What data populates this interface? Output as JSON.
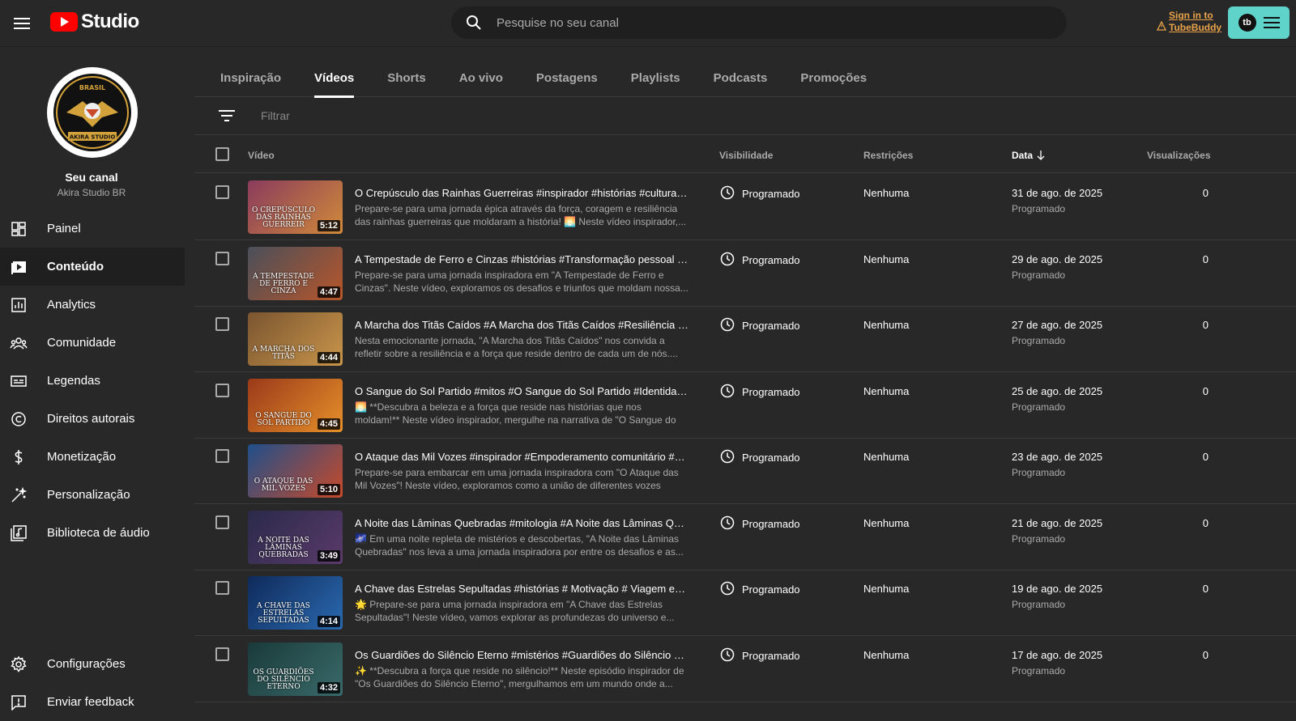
{
  "header": {
    "logo_text": "Studio",
    "search_placeholder": "Pesquise no seu canal",
    "tubebuddy_sign_line1": "Sign in to",
    "tubebuddy_sign_line2": "TubeBuddy",
    "tubebuddy_badge": "tb"
  },
  "sidebar": {
    "channel_title": "Seu canal",
    "channel_name": "Akira Studio BR",
    "avatar_text_top": "BRASIL",
    "avatar_text_bottom": "AKIRA STUDIO",
    "items": [
      {
        "label": "Painel",
        "icon": "dashboard-icon"
      },
      {
        "label": "Conteúdo",
        "icon": "content-icon"
      },
      {
        "label": "Analytics",
        "icon": "analytics-icon"
      },
      {
        "label": "Comunidade",
        "icon": "community-icon"
      },
      {
        "label": "Legendas",
        "icon": "subtitles-icon"
      },
      {
        "label": "Direitos autorais",
        "icon": "copyright-icon"
      },
      {
        "label": "Monetização",
        "icon": "dollar-icon"
      },
      {
        "label": "Personalização",
        "icon": "magic-wand-icon"
      },
      {
        "label": "Biblioteca de áudio",
        "icon": "audio-library-icon"
      }
    ],
    "bottom": [
      {
        "label": "Configurações",
        "icon": "gear-icon"
      },
      {
        "label": "Enviar feedback",
        "icon": "feedback-icon"
      }
    ]
  },
  "tabs": [
    "Inspiração",
    "Vídeos",
    "Shorts",
    "Ao vivo",
    "Postagens",
    "Playlists",
    "Podcasts",
    "Promoções"
  ],
  "active_tab": "Vídeos",
  "filter_placeholder": "Filtrar",
  "columns": {
    "video": "Vídeo",
    "visibility": "Visibilidade",
    "restrictions": "Restrições",
    "date": "Data",
    "views": "Visualizações"
  },
  "videos": [
    {
      "title": "O Crepúsculo das Rainhas Guerreiras #inspirador #histórias #cultura #i...",
      "desc": "Prepare-se para uma jornada épica através da força, coragem e resiliência das rainhas guerreiras que moldaram a história! 🌅 Neste vídeo inspirador,...",
      "duration": "5:12",
      "thumb_text": "O CREPÚSCULO DAS RAINHAS GUERREIR",
      "visibility": "Programado",
      "restrictions": "Nenhuma",
      "date": "31 de ago. de 2025",
      "date_status": "Programado",
      "views": "0",
      "colors": [
        "#8a3b5c",
        "#d08a3a"
      ]
    },
    {
      "title": "A Tempestade de Ferro e Cinzas #histórias #Transformação pessoal #...",
      "desc": "Prepare-se para uma jornada inspiradora em \"A Tempestade de Ferro e Cinzas\". Neste vídeo, exploramos os desafios e triunfos que moldam nossa...",
      "duration": "4:47",
      "thumb_text": "A TEMPESTADE DE FERRO E CINZA",
      "visibility": "Programado",
      "restrictions": "Nenhuma",
      "date": "29 de ago. de 2025",
      "date_status": "Programado",
      "views": "0",
      "colors": [
        "#4a4f5a",
        "#b8562a"
      ]
    },
    {
      "title": "A Marcha dos Titãs Caídos #A Marcha dos Titãs Caídos #Resiliência #...",
      "desc": "Nesta emocionante jornada, \"A Marcha dos Titãs Caídos\" nos convida a refletir sobre a resiliência e a força que reside dentro de cada um de nós....",
      "duration": "4:44",
      "thumb_text": "A MARCHA DOS TITÃS",
      "visibility": "Programado",
      "restrictions": "Nenhuma",
      "date": "27 de ago. de 2025",
      "date_status": "Programado",
      "views": "0",
      "colors": [
        "#7a5530",
        "#c9954a"
      ]
    },
    {
      "title": "O Sangue do Sol Partido #mitos #O Sangue do Sol Partido #Identidade ...",
      "desc": "🌅 **Descubra a beleza e a força que reside nas histórias que nos moldam!** Neste vídeo inspirador, mergulhe na narrativa de \"O Sangue do Sol Partido\",...",
      "duration": "4:45",
      "thumb_text": "O SANGUE DO SOL PARTIDO",
      "visibility": "Programado",
      "restrictions": "Nenhuma",
      "date": "25 de ago. de 2025",
      "date_status": "Programado",
      "views": "0",
      "colors": [
        "#9a3a1a",
        "#e6902a"
      ]
    },
    {
      "title": "O Ataque das Mil Vozes #inspirador #Empoderamento comunitário #E...",
      "desc": "Prepare-se para embarcar em uma jornada inspiradora com \"O Ataque das Mil Vozes\"! Neste vídeo, exploramos como a união de diferentes vozes pode...",
      "duration": "5:10",
      "thumb_text": "O ATAQUE DAS MIL VOZES",
      "visibility": "Programado",
      "restrictions": "Nenhuma",
      "date": "23 de ago. de 2025",
      "date_status": "Programado",
      "views": "0",
      "colors": [
        "#1f4f8a",
        "#c84a2a"
      ]
    },
    {
      "title": "A Noite das Lâminas Quebradas #mitologia #A Noite das Lâminas Que...",
      "desc": "🌌 Em uma noite repleta de mistérios e descobertas, \"A Noite das Lâminas Quebradas\" nos leva a uma jornada inspiradora por entre os desafios e as...",
      "duration": "3:49",
      "thumb_text": "A NOITE DAS LÂMINAS QUEBRADAS",
      "visibility": "Programado",
      "restrictions": "Nenhuma",
      "date": "21 de ago. de 2025",
      "date_status": "Programado",
      "views": "0",
      "colors": [
        "#2a2a4a",
        "#5a3a6a"
      ]
    },
    {
      "title": "A Chave das Estrelas Sepultadas #histórias # Motivação # Viagem espi...",
      "desc": "🌟 Prepare-se para uma jornada inspiradora em \"A Chave das Estrelas Sepultadas\"! Neste vídeo, vamos explorar as profundezas do universo e...",
      "duration": "4:14",
      "thumb_text": "A CHAVE DAS ESTRELAS SEPULTADAS",
      "visibility": "Programado",
      "restrictions": "Nenhuma",
      "date": "19 de ago. de 2025",
      "date_status": "Programado",
      "views": "0",
      "colors": [
        "#0f2a5a",
        "#2a6ab0"
      ]
    },
    {
      "title": "Os Guardiões do Silêncio Eterno #mistérios #Guardiões do Silêncio Eter...",
      "desc": "✨ **Descubra a força que reside no silêncio!** Neste episódio inspirador de \"Os Guardiões do Silêncio Eterno\", mergulhamos em um mundo onde a...",
      "duration": "4:32",
      "thumb_text": "OS GUARDIÕES DO SILÊNCIO ETERNO",
      "visibility": "Programado",
      "restrictions": "Nenhuma",
      "date": "17 de ago. de 2025",
      "date_status": "Programado",
      "views": "0",
      "colors": [
        "#1a3a3a",
        "#3a6a6a"
      ]
    }
  ]
}
